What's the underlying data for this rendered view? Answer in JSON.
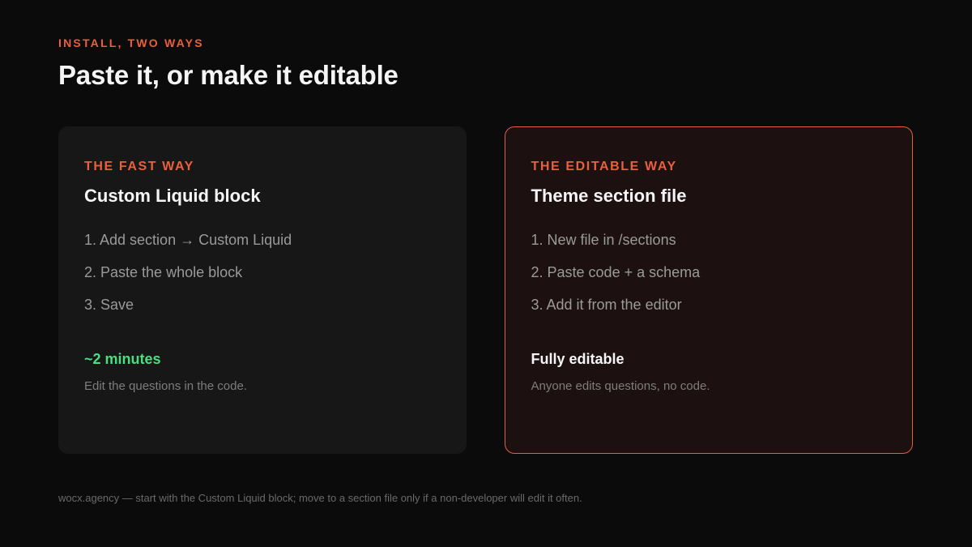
{
  "header": {
    "eyebrow": "INSTALL, TWO WAYS",
    "title": "Paste it, or make it editable"
  },
  "cards": [
    {
      "eyebrow": "THE FAST WAY",
      "title": "Custom Liquid block",
      "steps": [
        "1. Add section → Custom Liquid",
        "2. Paste the whole block",
        "3. Save"
      ],
      "result": "~2 minutes",
      "note": "Edit the questions in the code."
    },
    {
      "eyebrow": "THE EDITABLE WAY",
      "title": "Theme section file",
      "steps": [
        "1. New file in /sections",
        "2. Paste code + a schema",
        "3. Add it from the editor"
      ],
      "result": "Fully editable",
      "note": "Anyone edits questions, no code."
    }
  ],
  "footer": "wocx.agency — start with the Custom Liquid block; move to a section file only if a non-developer will edit it often.",
  "colors": {
    "accent": "#e8603c",
    "success": "#4ade80",
    "background": "#0b0b0b",
    "card": "#171717",
    "card_highlight": "#1c1110"
  }
}
